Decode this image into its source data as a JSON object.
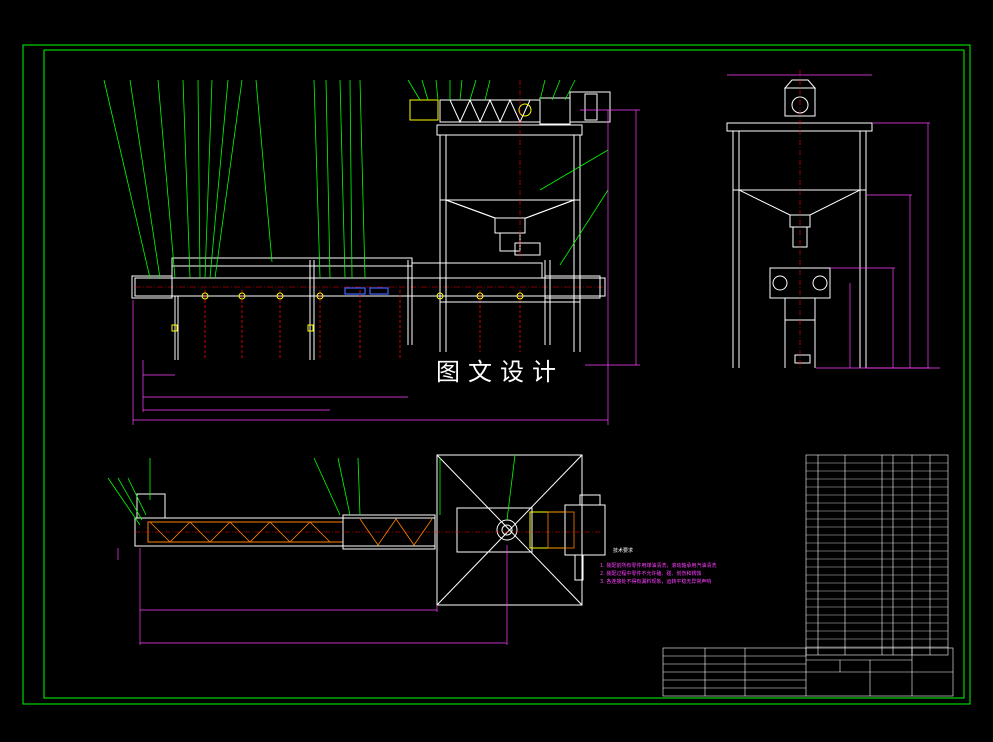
{
  "watermark": "图文设计",
  "colors": {
    "background": "#000000",
    "frame": "#00ff00",
    "leader": "#00ff00",
    "structure": "#ffffff",
    "dimension": "#ff40ff",
    "centerline": "#ff0000",
    "hidden": "#ffff00",
    "accent_blue": "#4060ff"
  },
  "notes": {
    "title": "技术要求",
    "lines": [
      "1. 装配前所有零件用煤油清洗，滚动轴承用汽油清洗",
      "2. 装配过程中零件不允许磕、碰、划伤和锈蚀",
      "3. 各连接处不得有漏料现象，运转平稳无异常声响"
    ]
  }
}
